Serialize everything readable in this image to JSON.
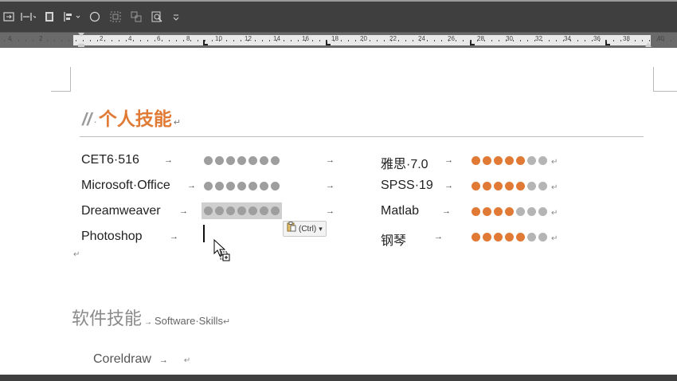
{
  "colors": {
    "accent": "#e07a35",
    "gray_dot": "#9e9e9e",
    "light_dot": "#b5b5b5",
    "divider": "#bdbdbd"
  },
  "toolbar": {
    "icons": [
      "frame-icon",
      "align-spread-icon",
      "page-icon",
      "align-icon",
      "circle-icon",
      "group-icon",
      "ungroup-icon",
      "zoom-page-icon",
      "more-icon"
    ]
  },
  "ruler": {
    "labels": [
      "4",
      "2",
      "2",
      "4",
      "6",
      "8",
      "10",
      "12",
      "14",
      "16",
      "18",
      "20",
      "22",
      "24",
      "26",
      "28",
      "30",
      "32",
      "34",
      "36",
      "38",
      "40"
    ]
  },
  "heading": {
    "prefix": "//",
    "dot": "·",
    "title": "个人技能",
    "mark": "↵"
  },
  "skills_left": [
    {
      "label": "CET6·516",
      "level": 7,
      "max": 7
    },
    {
      "label": "Microsoft·Office",
      "level": 7,
      "max": 7
    },
    {
      "label": "Dreamweaver",
      "level": 7,
      "max": 7
    },
    {
      "label": "Photoshop",
      "level": 0,
      "max": 7
    }
  ],
  "skills_right": [
    {
      "label": "雅思·7.0",
      "level": 5,
      "max": 7
    },
    {
      "label": "SPSS·19",
      "level": 5,
      "max": 7
    },
    {
      "label": "Matlab",
      "level": 4,
      "max": 7
    },
    {
      "label": "钢琴",
      "level": 5,
      "max": 7
    }
  ],
  "tab_arrow": "→",
  "para_mark": "↵",
  "paste_options": {
    "label": "(Ctrl)",
    "chevron": "▾"
  },
  "section2": {
    "title": "软件技能",
    "arrow": "→",
    "subtitle": "Software·Skills",
    "mark": "↵"
  },
  "section2_items": [
    {
      "label": "Coreldraw"
    }
  ]
}
